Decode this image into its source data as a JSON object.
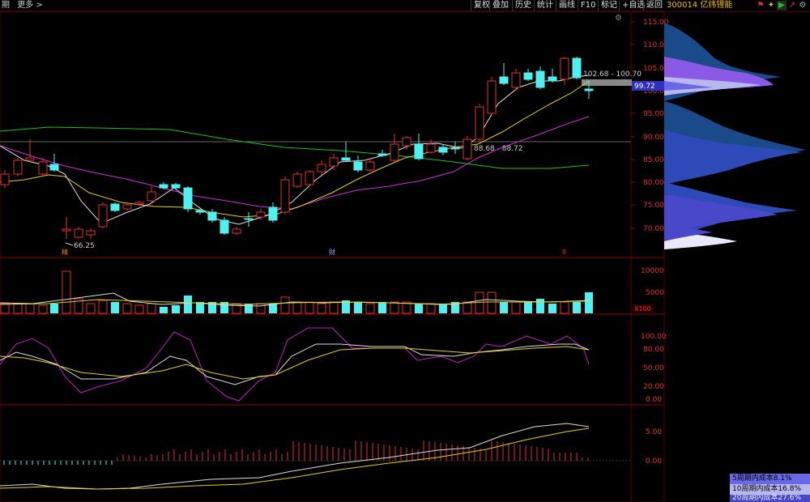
{
  "toolbar": {
    "left_items": [
      "期",
      "更多 >"
    ],
    "buttons": [
      "复权",
      "叠加",
      "历史",
      "统计",
      "画线",
      "F10",
      "标记",
      "+自选",
      "返回"
    ],
    "stock_code": "300014 亿纬锂能"
  },
  "price_axis": {
    "labels": [
      "115.00",
      "110.00",
      "105.00",
      "100.00",
      "95.00",
      "90.00",
      "85.00",
      "80.00",
      "75.00",
      "70.00"
    ],
    "current_price": "99.72"
  },
  "annotations": {
    "high_range": "102.68 - 100.70",
    "mid_range": "88.68 - 88.72",
    "low_point": "66.25",
    "marker_1": "精",
    "marker_2": "财",
    "marker_3": "8"
  },
  "volume_axis": {
    "labels": [
      "10000",
      "5000"
    ],
    "unit": "X100"
  },
  "kdj_axis": {
    "labels": [
      "100.00",
      "80.00",
      "50.00",
      "20.00",
      "0.00"
    ]
  },
  "macd_axis": {
    "labels": [
      "5.00",
      "0.00"
    ]
  },
  "legend": {
    "items": [
      "5周期内成本8.1%",
      "10周期内成本16.8%",
      "20周期内成本27.6%"
    ]
  },
  "colors": {
    "up": "#e03030",
    "down": "#4ff0f0",
    "ma5": "#e0e0e0",
    "ma10": "#f0e020",
    "ma20": "#e030e0",
    "ma60": "#20c020",
    "grid": "#400000"
  }
}
